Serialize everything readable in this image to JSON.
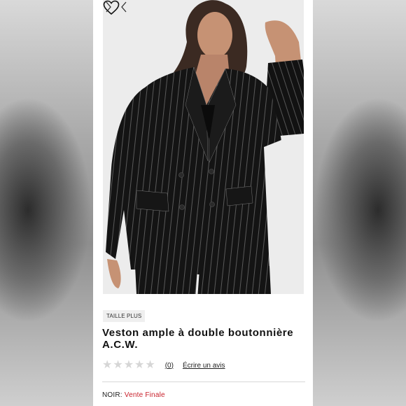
{
  "product": {
    "badge": "TAILLE PLUS",
    "title": "Veston ample à double boutonnière A.C.W.",
    "rating": {
      "stars_filled": 0,
      "stars_total": 5,
      "count_label": "(0)",
      "write_review_label": "Écrire un avis"
    },
    "color_label": "NOIR:",
    "sale_label": "Vente Finale"
  },
  "icons": {
    "wishlist": "heart-outline-icon",
    "prev": "chevron-left-icon",
    "next": "chevron-right-icon",
    "star": "star-icon"
  },
  "colors": {
    "sale_text": "#c8202b",
    "star_empty": "#d6d6d6"
  }
}
